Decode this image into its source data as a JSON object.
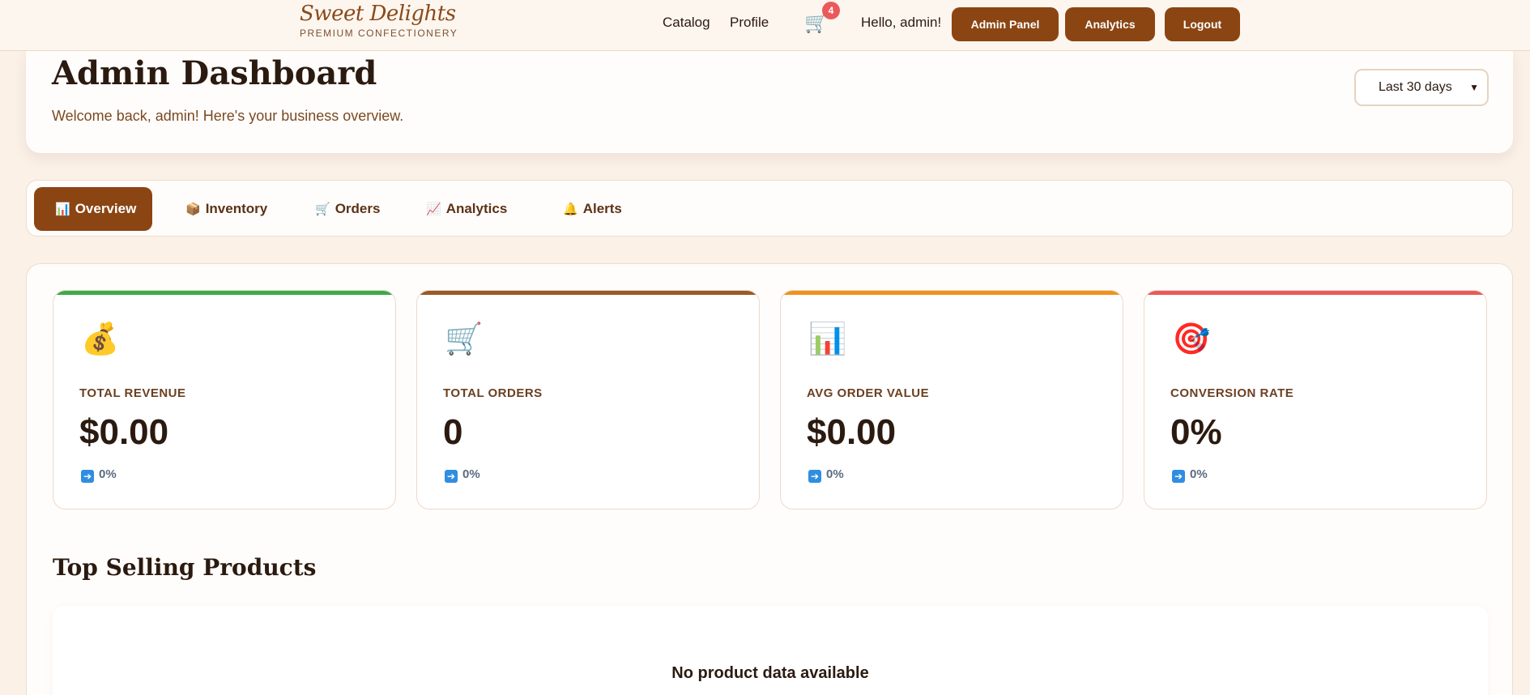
{
  "brand": {
    "name": "Sweet Delights",
    "tagline": "PREMIUM CONFECTIONERY"
  },
  "nav": {
    "catalog": "Catalog",
    "profile": "Profile",
    "cart_count": "4",
    "greeting": "Hello, admin!",
    "admin_panel": "Admin Panel",
    "analytics": "Analytics",
    "logout": "Logout"
  },
  "dashboard": {
    "title": "Admin Dashboard",
    "subtitle": "Welcome back, admin! Here's your business overview.",
    "range": "Last 30 days"
  },
  "tabs": [
    {
      "icon": "📊",
      "label": "Overview",
      "active": true
    },
    {
      "icon": "📦",
      "label": "Inventory",
      "active": false
    },
    {
      "icon": "🛒",
      "label": "Orders",
      "active": false
    },
    {
      "icon": "📈",
      "label": "Analytics",
      "active": false
    },
    {
      "icon": "🔔",
      "label": "Alerts",
      "active": false
    }
  ],
  "stats": [
    {
      "icon": "💰",
      "label": "TOTAL REVENUE",
      "value": "$0.00",
      "change": "0%",
      "accent": "#3faa4a"
    },
    {
      "icon": "🛒",
      "label": "TOTAL ORDERS",
      "value": "0",
      "change": "0%",
      "accent": "#9a5a28"
    },
    {
      "icon": "📊",
      "label": "AVG ORDER VALUE",
      "value": "$0.00",
      "change": "0%",
      "accent": "#f0921e"
    },
    {
      "icon": "🎯",
      "label": "CONVERSION RATE",
      "value": "0%",
      "change": "0%",
      "accent": "#ea5a5a"
    }
  ],
  "top_products": {
    "title": "Top Selling Products",
    "empty_message": "No product data available"
  },
  "colors": {
    "primary": "#8b4513",
    "background": "#fbf1e7",
    "badge": "#ea5a5a"
  }
}
